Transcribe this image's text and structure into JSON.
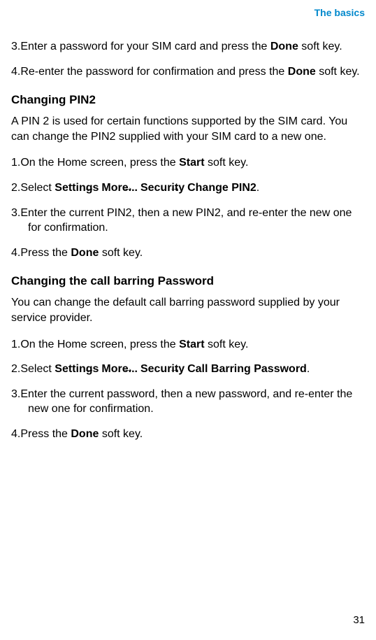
{
  "header": "The basics",
  "pageNumber": "31",
  "section1_list": {
    "item3_num": "3.",
    "item3_a": "Enter a password for your SIM card and press the ",
    "item3_b": "Done",
    "item3_c": " soft key.",
    "item4_num": "4.",
    "item4_a": "Re-enter the password for confirmation and press the ",
    "item4_b": "Done",
    "item4_c": " soft key."
  },
  "section2": {
    "heading": "Changing PIN2",
    "intro": "A PIN 2 is used for certain functions supported by the SIM card. You can change the PIN2 supplied with your SIM card to a new one.",
    "item1_num": "1.",
    "item1_a": "On the Home screen, press the ",
    "item1_b": "Start",
    "item1_c": " soft key.",
    "item2_num": "2.",
    "item2_a": "Select ",
    "item2_b1": "Settings",
    "item2_arr": " → ",
    "item2_b2": "More...",
    "item2_b3": "Security",
    "item2_b4": "Change PIN2",
    "item2_c": ".",
    "item3_num": "3.",
    "item3_a": "Enter the current PIN2, then a new PIN2, and re-enter the new one for confirmation.",
    "item4_num": "4.",
    "item4_a": "Press the ",
    "item4_b": "Done",
    "item4_c": " soft key."
  },
  "section3": {
    "heading": "Changing the call barring Password",
    "intro": "You can change the default call barring password supplied by your service provider.",
    "item1_num": "1.",
    "item1_a": "On the Home screen, press the ",
    "item1_b": "Start",
    "item1_c": " soft key.",
    "item2_num": "2.",
    "item2_a": "Select ",
    "item2_b1": "Settings",
    "item2_arr": " → ",
    "item2_b2": "More...",
    "item2_b3": "Security",
    "item2_b4": "Call Barring Password",
    "item2_c": ".",
    "item3_num": "3.",
    "item3_a": "Enter the current password, then a new password, and re-enter the new one for confirmation.",
    "item4_num": "4.",
    "item4_a": "Press the ",
    "item4_b": "Done",
    "item4_c": " soft key."
  }
}
